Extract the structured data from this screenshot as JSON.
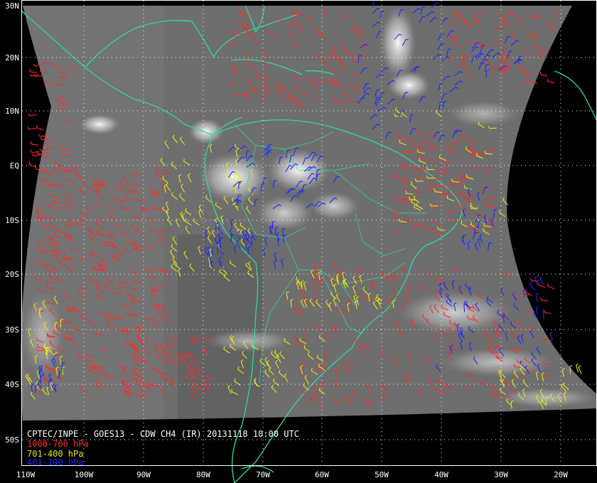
{
  "title": "CPTEC/INPE - GOES13 - CDW CH4 (IR) 20131118 10:00 UTC",
  "colors": {
    "background": "#000000",
    "image_gray": "#6e6e6e",
    "coastline": "#2ed9a0",
    "grid": "#ffffff",
    "low_level": "#ff2a2a",
    "mid_level": "#e6e619",
    "high_level": "#1a2aff"
  },
  "legend": [
    {
      "label": "1000-700 hPa",
      "color": "#ff2a2a"
    },
    {
      "label": "701-400 hPa",
      "color": "#e6e619"
    },
    {
      "label": "401-100 hPa",
      "color": "#1a2aff"
    }
  ],
  "latitude_labels": [
    "30N",
    "20N",
    "10N",
    "EQ",
    "10S",
    "20S",
    "30S",
    "40S",
    "50S"
  ],
  "longitude_labels": [
    "110W",
    "100W",
    "90W",
    "80W",
    "70W",
    "60W",
    "50W",
    "40W",
    "30W",
    "20W"
  ],
  "map_features": [
    "coastlines",
    "country-borders",
    "state-borders",
    "lat-lon-grid",
    "wind-barbs",
    "cloud-tops"
  ]
}
